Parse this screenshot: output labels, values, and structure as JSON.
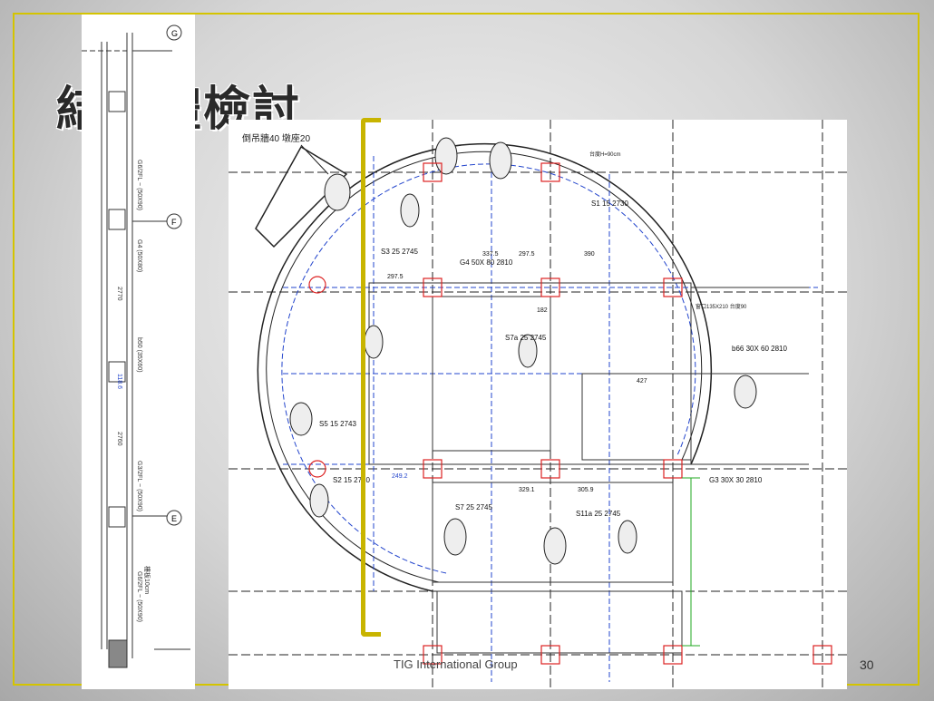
{
  "slide": {
    "title": "結構體檢討",
    "footer": "TIG International Group",
    "page_number": "30",
    "accent_color": "#d4c400"
  },
  "section": {
    "axis_g": "G",
    "axis_f": "F",
    "axis_e": "E",
    "annotations": [
      "G6/2FL ~ (50X90)",
      "G4 (50X80)",
      "b50 (35X60)",
      "G3/2FL ~ (50X90)",
      "G6/2FL ~ (50X90)",
      "樓板10cm",
      "2770",
      "2760",
      "118.6"
    ]
  },
  "plan": {
    "note_top_left": "倒吊牆40 墩座20",
    "note_top": "台度H=90cm",
    "note_right": "窗口135X210 台度90",
    "slab_labels": [
      "S7a 25 2745",
      "S3 25 2745",
      "S11a 25 2745",
      "S1 15 2730",
      "S2 15 2730",
      "S5 15 2743",
      "S7 25 2745"
    ],
    "beam_labels": [
      "G4 50X 80 2810",
      "G3 30X 30 2810",
      "b66 30X 60 2810"
    ],
    "dimensions": [
      "297.5",
      "337.5",
      "297.5",
      "390",
      "427",
      "329.1",
      "305.9",
      "249.2",
      "182"
    ]
  }
}
